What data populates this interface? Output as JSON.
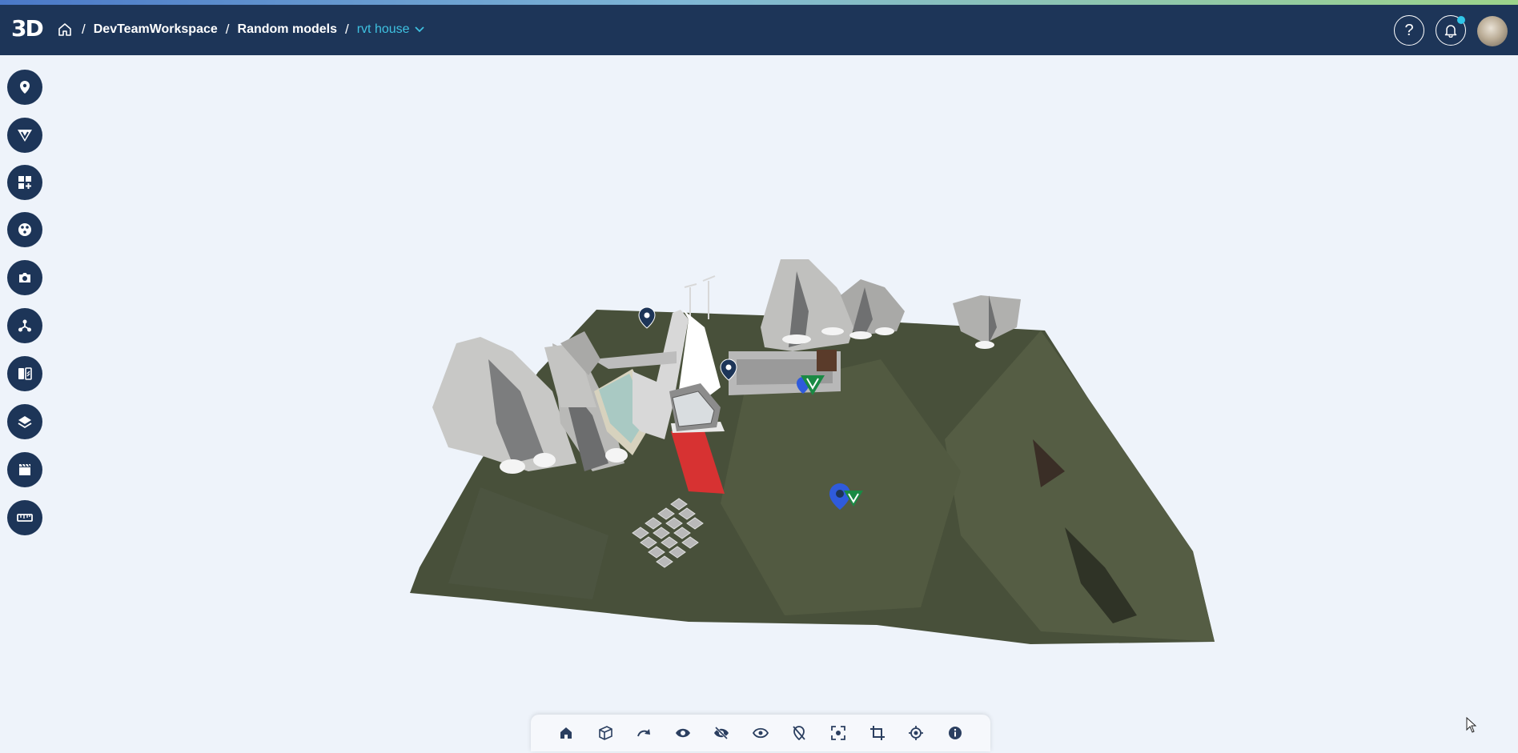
{
  "app": {
    "logo_text": "3D",
    "accent_color": "#3fc1e0",
    "header_color": "#1d3558"
  },
  "breadcrumb": {
    "home_icon": "home-icon",
    "items": [
      "DevTeamWorkspace",
      "Random models"
    ],
    "current": "rvt house",
    "separator": "/"
  },
  "header_right": {
    "help_label": "?",
    "notification_badge": true
  },
  "sidebar": {
    "items": [
      {
        "name": "location-pin",
        "icon": "map-pin-icon"
      },
      {
        "name": "viewpoint",
        "icon": "v-shield-icon"
      },
      {
        "name": "add-widget",
        "icon": "grid-plus-icon"
      },
      {
        "name": "materials",
        "icon": "palette-icon"
      },
      {
        "name": "screenshot",
        "icon": "camera-icon"
      },
      {
        "name": "network",
        "icon": "nodes-icon"
      },
      {
        "name": "compare",
        "icon": "split-compare-icon"
      },
      {
        "name": "layers",
        "icon": "layers-icon"
      },
      {
        "name": "animation",
        "icon": "clapperboard-icon"
      },
      {
        "name": "measure",
        "icon": "ruler-icon"
      }
    ]
  },
  "toolbar": {
    "items": [
      {
        "name": "home-view",
        "icon": "home-icon"
      },
      {
        "name": "view-cube",
        "icon": "cube-icon"
      },
      {
        "name": "redo",
        "icon": "redo-icon"
      },
      {
        "name": "show",
        "icon": "eye-icon"
      },
      {
        "name": "hide",
        "icon": "eye-off-icon"
      },
      {
        "name": "isolate",
        "icon": "eye-outline-icon"
      },
      {
        "name": "pin-off",
        "icon": "pin-off-icon"
      },
      {
        "name": "focus",
        "icon": "focus-frame-icon"
      },
      {
        "name": "crop",
        "icon": "crop-icon"
      },
      {
        "name": "locate",
        "icon": "crosshair-icon"
      },
      {
        "name": "info",
        "icon": "info-icon"
      }
    ]
  }
}
